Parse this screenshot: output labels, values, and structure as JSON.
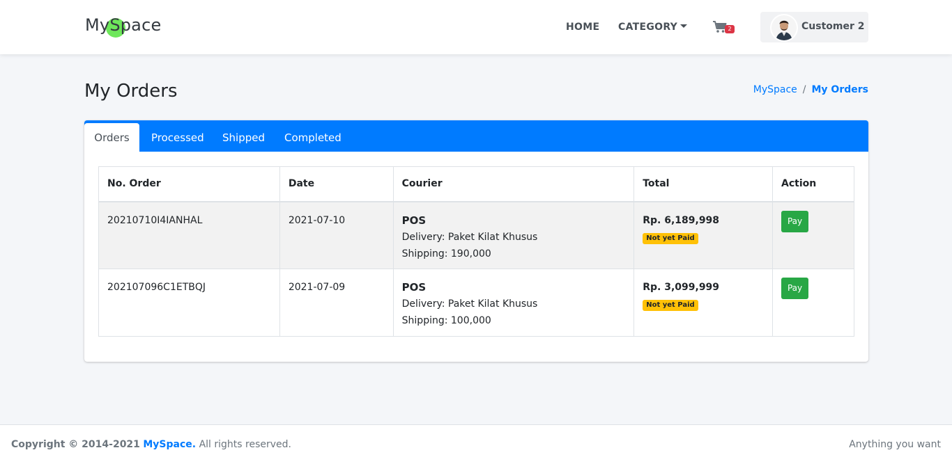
{
  "navbar": {
    "brand_prefix": "My",
    "brand_highlight": "S",
    "brand_suffix": "pace",
    "home_label": "HOME",
    "category_label": "CATEGORY",
    "cart_count": "2",
    "user_name": "Customer 2"
  },
  "header": {
    "title": "My Orders",
    "breadcrumb": {
      "root": "MySpace",
      "separator": "/",
      "current": "My Orders"
    }
  },
  "tabs": [
    {
      "label": "Orders",
      "active": true
    },
    {
      "label": "Processed",
      "active": false
    },
    {
      "label": "Shipped",
      "active": false
    },
    {
      "label": "Completed",
      "active": false
    }
  ],
  "table": {
    "columns": [
      "No. Order",
      "Date",
      "Courier",
      "Total",
      "Action"
    ],
    "rows": [
      {
        "order_no": "20210710I4IANHAL",
        "date": "2021-07-10",
        "courier": "POS",
        "delivery": "Delivery: Paket Kilat Khusus",
        "shipping": "Shipping: 190,000",
        "total": "Rp. 6,189,998",
        "status": "Not yet Paid",
        "action": "Pay"
      },
      {
        "order_no": "202107096C1ETBQJ",
        "date": "2021-07-09",
        "courier": "POS",
        "delivery": "Delivery: Paket Kilat Khusus",
        "shipping": "Shipping: 100,000",
        "total": "Rp. 3,099,999",
        "status": "Not yet Paid",
        "action": "Pay"
      }
    ]
  },
  "footer": {
    "copyright_prefix": "Copyright © 2014-2021",
    "brand": "MySpace.",
    "rights": "All rights reserved.",
    "tagline": "Anything you want"
  },
  "colors": {
    "primary": "#007bff",
    "success": "#28a745",
    "warning": "#ffc107",
    "danger": "#dc3545",
    "brand_dot": "#6ee75b"
  },
  "icons": {
    "cart": "shopping-cart-icon",
    "caret": "caret-down-icon",
    "avatar": "user-avatar"
  }
}
